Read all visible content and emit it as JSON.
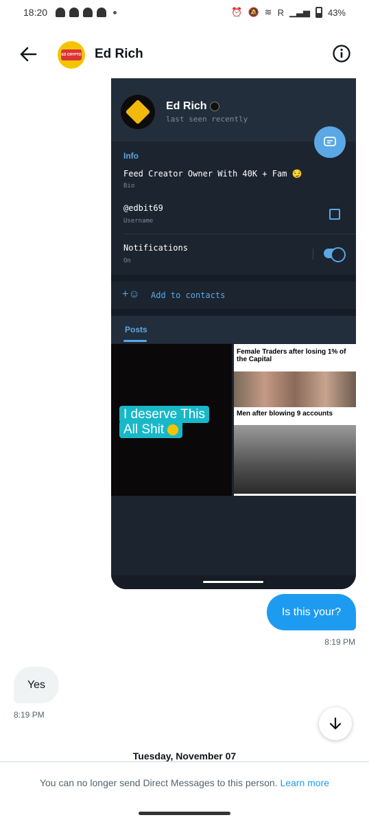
{
  "status_bar": {
    "time": "18:20",
    "carrier": "R",
    "battery": "43%"
  },
  "header": {
    "title": "Ed Rich",
    "avatar_text": "ED CRYPTO"
  },
  "telegram_profile": {
    "name": "Ed Rich",
    "status": "last seen recently",
    "info_title": "Info",
    "bio": "Feed Creator Owner With 40K + Fam 😏",
    "bio_label": "Bio",
    "username": "@edbit69",
    "username_label": "Username",
    "notifications": "Notifications",
    "notifications_state": "On",
    "add_contacts": "Add to contacts",
    "tab_posts": "Posts",
    "post1_line1": "I deserve This",
    "post1_line2": "All Shit",
    "post2_caption1": "Female Traders after losing 1% of the Capital",
    "post2_caption2": "Men after blowing 9 accounts"
  },
  "messages": [
    {
      "text": "Is this your?",
      "time": "8:19 PM",
      "direction": "outgoing"
    },
    {
      "text": "Yes",
      "time": "8:19 PM",
      "direction": "incoming"
    }
  ],
  "date_separator": "Tuesday, November 07",
  "footer": {
    "text": "You can no longer send Direct Messages to this person.",
    "link": "Learn more"
  },
  "colors": {
    "accent": "#1d9bf0",
    "telegram_accent": "#5aa8e6",
    "telegram_bg": "#1c242f"
  }
}
